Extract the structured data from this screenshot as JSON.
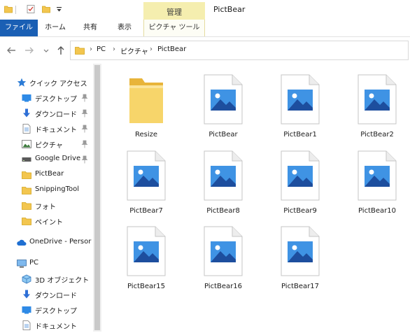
{
  "window": {
    "title": "PictBear",
    "contextual_tab_group": "管理",
    "accent_color": "#1a5fb4",
    "contextual_color": "#f5eeaf"
  },
  "quick_access_toolbar": {
    "icons": [
      "folder-icon",
      "properties-icon",
      "new-folder-icon",
      "customize-dropdown-icon"
    ]
  },
  "ribbon": {
    "tabs": [
      {
        "label": "ファイル",
        "name": "tab-file"
      },
      {
        "label": "ホーム",
        "name": "tab-home"
      },
      {
        "label": "共有",
        "name": "tab-share"
      },
      {
        "label": "表示",
        "name": "tab-view"
      },
      {
        "label": "ピクチャ ツール",
        "name": "tab-picture-tools"
      }
    ]
  },
  "address": {
    "breadcrumbs": [
      "PC",
      "ピクチャ",
      "PictBear"
    ]
  },
  "sidebar": {
    "items": [
      {
        "label": "クイック アクセス",
        "icon": "star-icon",
        "pinned": false
      },
      {
        "label": "デスクトップ",
        "icon": "desktop-icon",
        "pinned": true
      },
      {
        "label": "ダウンロード",
        "icon": "download-arrow-icon",
        "pinned": true
      },
      {
        "label": "ドキュメント",
        "icon": "document-icon",
        "pinned": true
      },
      {
        "label": "ピクチャ",
        "icon": "pictures-icon",
        "pinned": true
      },
      {
        "label": "Google Drive",
        "icon": "drive-icon",
        "pinned": true
      },
      {
        "label": "PictBear",
        "icon": "folder-icon",
        "pinned": false
      },
      {
        "label": "SnippingTool",
        "icon": "folder-icon",
        "pinned": false
      },
      {
        "label": "フォト",
        "icon": "folder-icon",
        "pinned": false
      },
      {
        "label": "ペイント",
        "icon": "folder-icon",
        "pinned": false
      },
      {
        "label": "OneDrive - Persor",
        "icon": "onedrive-cloud-icon",
        "pinned": false
      },
      {
        "label": "PC",
        "icon": "pc-icon",
        "pinned": false
      },
      {
        "label": "3D オブジェクト",
        "icon": "3d-objects-icon",
        "pinned": false
      },
      {
        "label": "ダウンロード",
        "icon": "download-arrow-icon",
        "pinned": false
      },
      {
        "label": "デスクトップ",
        "icon": "desktop-icon",
        "pinned": false
      },
      {
        "label": "ドキュメント",
        "icon": "document-icon",
        "pinned": false
      }
    ]
  },
  "files": [
    {
      "name": "Resize",
      "type": "folder"
    },
    {
      "name": "PictBear",
      "type": "image"
    },
    {
      "name": "PictBear1",
      "type": "image"
    },
    {
      "name": "PictBear2",
      "type": "image"
    },
    {
      "name": "PictBear7",
      "type": "image"
    },
    {
      "name": "PictBear8",
      "type": "image"
    },
    {
      "name": "PictBear9",
      "type": "image"
    },
    {
      "name": "PictBear10",
      "type": "image"
    },
    {
      "name": "PictBear15",
      "type": "image"
    },
    {
      "name": "PictBear16",
      "type": "image"
    },
    {
      "name": "PictBear17",
      "type": "image"
    }
  ]
}
